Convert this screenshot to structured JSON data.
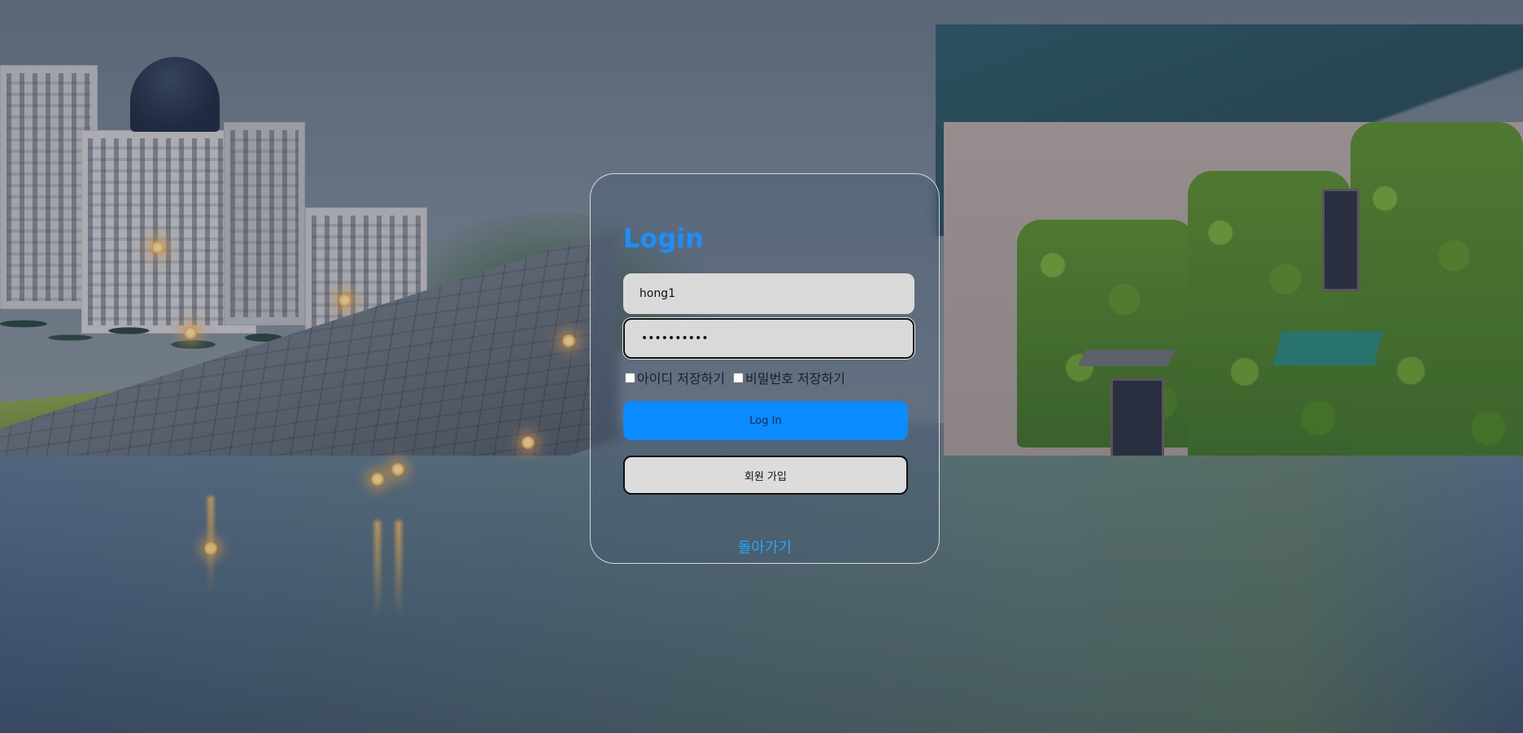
{
  "login": {
    "title": "Login",
    "username_value": "hong1",
    "password_value": "••••••••••",
    "remember_id_label": "아이디 저장하기",
    "remember_pw_label": "비밀번호 저장하기",
    "login_button": "Log In",
    "signup_button": "회원 가입",
    "back_link": "돌아가기"
  },
  "colors": {
    "accent": "#0a8bff",
    "title": "#1b8fff",
    "link": "#22a6ff",
    "input_bg": "#d9d9d9"
  }
}
